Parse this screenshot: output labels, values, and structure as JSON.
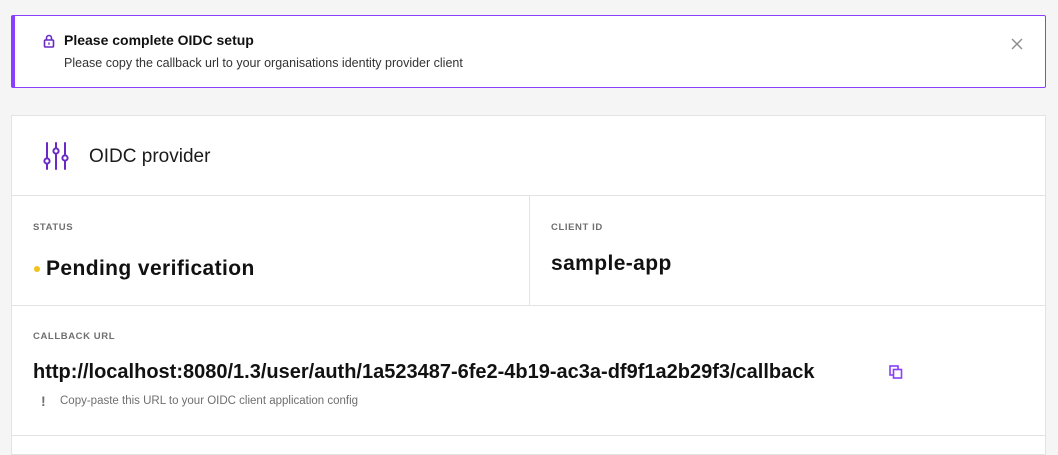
{
  "alert": {
    "title": "Please complete OIDC setup",
    "message": "Please copy the callback url to your organisations identity provider client",
    "accent_color": "#8a3ffc",
    "icon": "lock-icon",
    "close_icon": "close-icon"
  },
  "provider": {
    "title": "OIDC provider",
    "icon": "sliders-icon",
    "status_label": "STATUS",
    "status_value": "Pending verification",
    "status_color": "#f1c21b",
    "client_id_label": "CLIENT ID",
    "client_id_value": "sample-app",
    "callback_label": "CALLBACK URL",
    "callback_url": "http://localhost:8080/1.3/user/auth/1a523487-6fe2-4b19-ac3a-df9f1a2b29f3/callback",
    "copy_icon": "copy-icon",
    "helper_icon": "!",
    "helper_text": "Copy-paste this URL to your OIDC client application config"
  }
}
